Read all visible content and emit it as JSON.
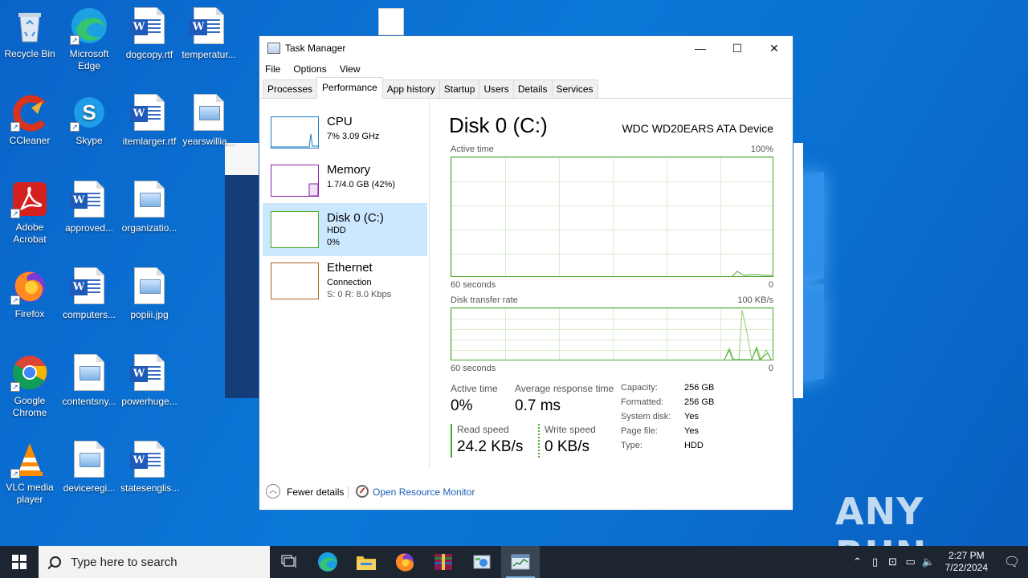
{
  "desktop": {
    "icons": [
      {
        "label": "Recycle Bin"
      },
      {
        "label": "Microsoft Edge"
      },
      {
        "label": "dogcopy.rtf"
      },
      {
        "label": "temperatur..."
      },
      {
        "label": "CCleaner"
      },
      {
        "label": "Skype"
      },
      {
        "label": "itemlarger.rtf"
      },
      {
        "label": "yearswillia..."
      },
      {
        "label": "Adobe Acrobat"
      },
      {
        "label": "approved..."
      },
      {
        "label": "organizatio..."
      },
      {
        "label": "Firefox"
      },
      {
        "label": "computers..."
      },
      {
        "label": "popiii.jpg"
      },
      {
        "label": "Google Chrome"
      },
      {
        "label": "contentsny..."
      },
      {
        "label": "powerhuge..."
      },
      {
        "label": "VLC media player"
      },
      {
        "label": "deviceregi..."
      },
      {
        "label": "statesenglis..."
      }
    ],
    "watermark": "ANY RUN"
  },
  "task_manager": {
    "title": "Task Manager",
    "window_buttons": {
      "minimize": "—",
      "maximize": "☐",
      "close": "✕"
    },
    "menu": [
      "File",
      "Options",
      "View"
    ],
    "tabs": [
      "Processes",
      "Performance",
      "App history",
      "Startup",
      "Users",
      "Details",
      "Services"
    ],
    "active_tab": "Performance",
    "resources": [
      {
        "name": "CPU",
        "line1": "7% 3.09 GHz",
        "line2": "",
        "color": "#1a7bc4"
      },
      {
        "name": "Memory",
        "line1": "1.7/4.0 GB (42%)",
        "line2": "",
        "color": "#8b1fa9"
      },
      {
        "name": "Disk 0 (C:)",
        "line1": "HDD",
        "line2": "0%",
        "color": "#4ca82e"
      },
      {
        "name": "Ethernet",
        "line1": "Connection",
        "line2": "S: 0 R: 8.0 Kbps",
        "color": "#a7651c"
      }
    ],
    "detail": {
      "title": "Disk 0 (C:)",
      "model": "WDC WD20EARS ATA Device",
      "graph1": {
        "label": "Active time",
        "max": "100%",
        "xlabel": "60 seconds",
        "min": "0"
      },
      "graph2": {
        "label": "Disk transfer rate",
        "max": "100 KB/s",
        "xlabel": "60 seconds",
        "min": "0"
      },
      "active_time_label": "Active time",
      "active_time_value": "0%",
      "avg_response_label": "Average response time",
      "avg_response_value": "0.7 ms",
      "read_speed_label": "Read speed",
      "read_speed_value": "24.2 KB/s",
      "write_speed_label": "Write speed",
      "write_speed_value": "0 KB/s",
      "properties": [
        {
          "key": "Capacity:",
          "value": "256 GB"
        },
        {
          "key": "Formatted:",
          "value": "256 GB"
        },
        {
          "key": "System disk:",
          "value": "Yes"
        },
        {
          "key": "Page file:",
          "value": "Yes"
        },
        {
          "key": "Type:",
          "value": "HDD"
        }
      ]
    },
    "footer": {
      "fewer_details": "Fewer details",
      "open_resource_monitor": "Open Resource Monitor"
    }
  },
  "taskbar": {
    "search_placeholder": "Type here to search",
    "time": "2:27 PM",
    "date": "7/22/2024"
  }
}
